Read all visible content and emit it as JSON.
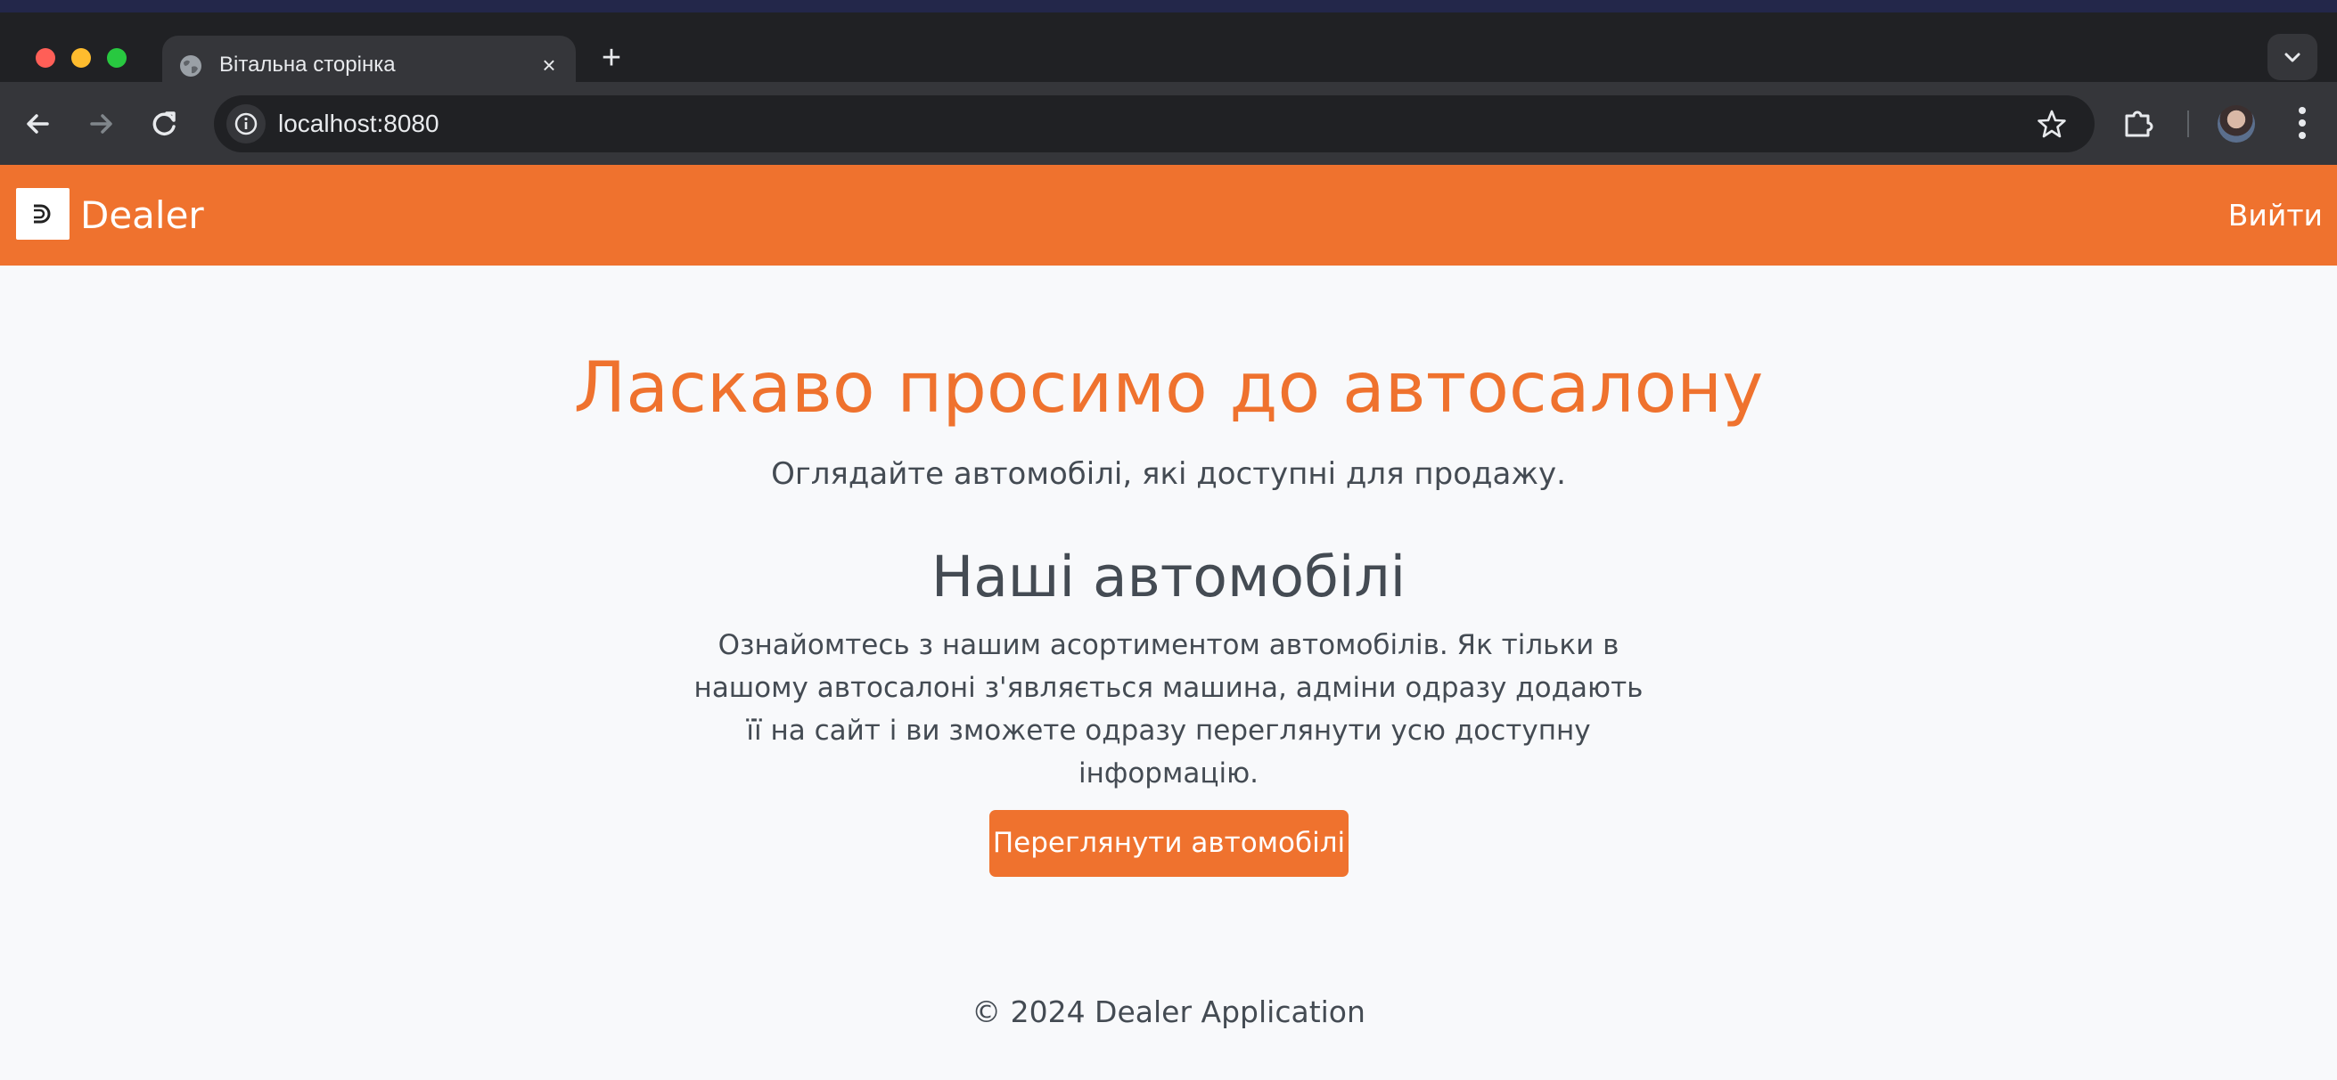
{
  "browser": {
    "tab_title": "Вітальна сторінка",
    "tab_close_glyph": "×",
    "new_tab_glyph": "+",
    "url": "localhost:8080",
    "icons": [
      "globe-icon",
      "close-icon",
      "plus-icon",
      "chevron-down-icon",
      "back-arrow-icon",
      "forward-arrow-icon",
      "reload-icon",
      "info-icon",
      "star-icon",
      "puzzle-icon",
      "avatar",
      "menu-dots-icon"
    ]
  },
  "navbar": {
    "brand_name": "Dealer",
    "logout_label": "Вийти",
    "background_color": "#ef722e"
  },
  "hero": {
    "title": "Ласкаво просимо до автосалону",
    "subtitle": "Оглядайте автомобілі, які доступні для продажу."
  },
  "cars_section": {
    "title": "Наші автомобілі",
    "description": "Ознайомтесь з нашим асортиментом автомобілів. Як тільки в нашому автосалоні з'являється машина, адміни одразу додають її на сайт і ви зможете одразу переглянути усю доступну інформацію.",
    "button_label": "Переглянути автомобілі"
  },
  "footer": {
    "text": "© 2024 Dealer Application"
  },
  "colors": {
    "accent": "#ef722e",
    "text": "#444b53",
    "page_background": "#f8f9fb",
    "chrome_dark": "#202124",
    "chrome_toolbar": "#35363a"
  }
}
